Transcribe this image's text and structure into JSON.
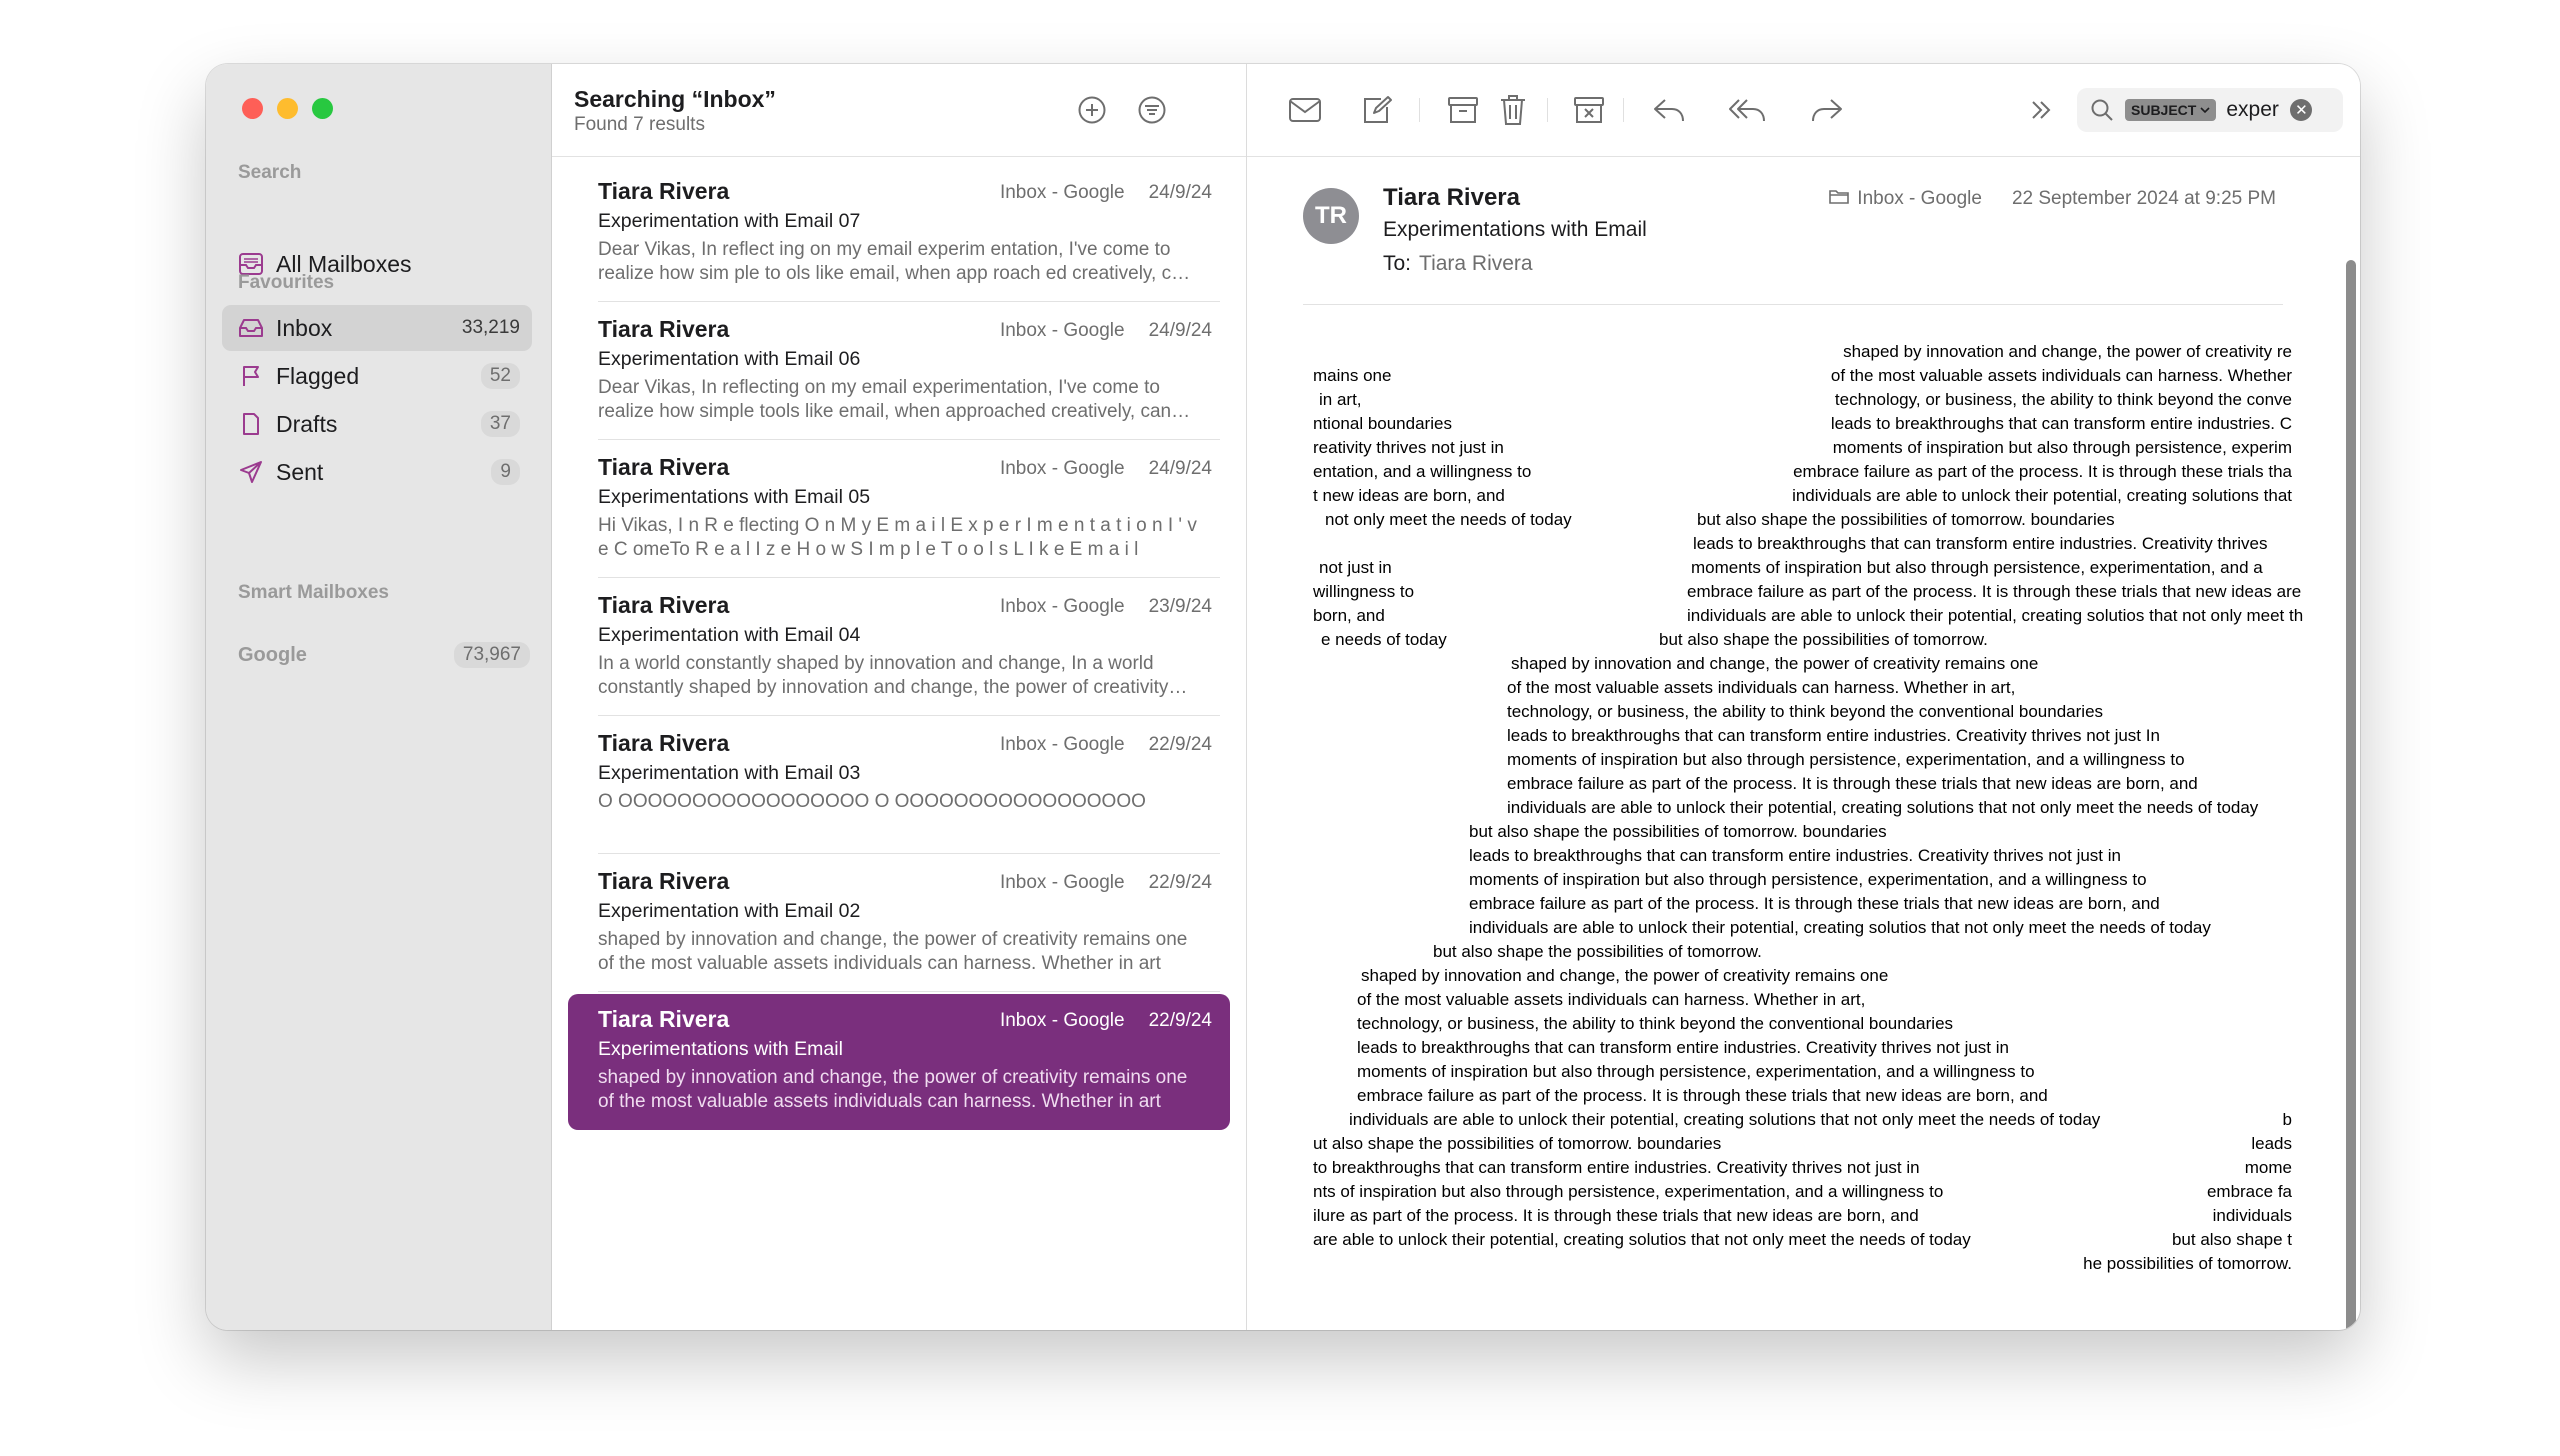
{
  "sidebar": {
    "search_section": "Search",
    "all_mailboxes": "All Mailboxes",
    "favourites_section": "Favourites",
    "items": [
      {
        "label": "Inbox",
        "count": "33,219"
      },
      {
        "label": "Flagged",
        "count": "52"
      },
      {
        "label": "Drafts",
        "count": "37"
      },
      {
        "label": "Sent",
        "count": "9"
      }
    ],
    "smart_section": "Smart Mailboxes",
    "google": {
      "label": "Google",
      "count": "73,967"
    }
  },
  "list": {
    "title": "Searching “Inbox”",
    "subtitle": "Found 7 results",
    "messages": [
      {
        "from": "Tiara Rivera",
        "mailbox": "Inbox - Google",
        "date": "24/9/24",
        "subject": "Experimentation with Email 07",
        "preview": "Dear Vikas, In reflect ing on my email experim entation, I've come to realize how sim ple to ols like email, when app roach ed creatively, can open up new possibilities"
      },
      {
        "from": "Tiara Rivera",
        "mailbox": "Inbox - Google",
        "date": "24/9/24",
        "subject": "Experimentation with Email 06",
        "preview": "Dear Vikas, In reflecting on my email experimentation, I've come to realize how simple tools like email, when approached creatively, can open up new possibilities"
      },
      {
        "from": "Tiara Rivera",
        "mailbox": "Inbox - Google",
        "date": "24/9/24",
        "subject": "Experimentations with Email 05",
        "preview": "Hi Vikas, I n R e flecting O n M y E m a i l E x p e r I m e n t a t i o n I ' v e C omeTo R e a l I z e H o w S I m p l e T o o l s L I k e E m a i l"
      },
      {
        "from": "Tiara Rivera",
        "mailbox": "Inbox - Google",
        "date": "23/9/24",
        "subject": "Experimentation with Email 04",
        "preview": "In a world constantly shaped by innovation and change, In a world constantly shaped by innovation and change, the power of creativity remains one"
      },
      {
        "from": "Tiara Rivera",
        "mailbox": "Inbox - Google",
        "date": "22/9/24",
        "subject": "Experimentation with Email 03",
        "preview": "O OOOOOOOOOOOOOOOOO O OOOOOOOOOOOOOOOOO"
      },
      {
        "from": "Tiara Rivera",
        "mailbox": "Inbox - Google",
        "date": "22/9/24",
        "subject": "Experimentation with Email 02",
        "preview": "shaped by innovation and change, the power of creativity remains one of the most valuable assets individuals can harness. Whether in art"
      },
      {
        "from": "Tiara Rivera",
        "mailbox": "Inbox - Google",
        "date": "22/9/24",
        "subject": "Experimentations with Email",
        "preview": "shaped by innovation and change, the power of creativity remains one of the most valuable assets individuals can harness. Whether in art"
      }
    ]
  },
  "search": {
    "token": "SUBJECT",
    "value": "exper"
  },
  "reader": {
    "avatar": "TR",
    "from": "Tiara Rivera",
    "subject": "Experimentations with Email",
    "to_label": "To:",
    "to": "Tiara Rivera",
    "mailbox": "Inbox - Google",
    "date": "22 September 2024 at 9:25 PM",
    "body_lines": [
      "shaped by innovation and change, the power of creativity re",
      "mains one",
      "of the most valuable assets individuals can harness. Whether",
      "in art,",
      "technology, or business, the ability to think beyond the conve",
      "ntional boundaries",
      "leads to breakthroughs that can transform entire industries. C",
      "reativity thrives not just in",
      "moments of inspiration but also through persistence, experim",
      "entation, and a willingness to",
      "embrace failure as part of the process. It is through these trials tha",
      "t new ideas are born, and",
      "individuals are able to unlock their potential, creating solutions that",
      "not only meet the needs of today",
      "but also shape the possibilities of tomorrow. boundaries",
      "leads to breakthroughs that can transform entire industries. Creativity thrives",
      "not just in",
      "moments of inspiration but also through persistence, experimentation, and a",
      "willingness to",
      "embrace failure as part of the process. It is through these trials that new ideas are",
      "born, and",
      "individuals are able to unlock their potential, creating solutios that not only meet th",
      "e needs of today",
      "but also shape the possibilities of tomorrow.",
      "shaped by innovation and change, the power of creativity remains one",
      "of the most valuable assets individuals can harness. Whether in art,",
      "technology, or business, the ability to think beyond the conventional boundaries",
      "leads to breakthroughs that can transform entire industries. Creativity thrives not just In",
      "moments of inspiration but also through persistence, experimentation, and a willingness to",
      "embrace failure as part of the process. It is through these trials that new ideas are born, and",
      "individuals are able to unlock their potential, creating solutions that not only meet the needs of today",
      "but also shape the possibilities of tomorrow. boundaries",
      "leads to breakthroughs that can transform entire industries. Creativity thrives not just in",
      "moments of inspiration but also through persistence, experimentation, and a willingness to",
      "embrace failure as part of the process. It is through these trials that new ideas are born, and",
      "individuals are able to unlock their potential, creating solutios that not only meet the needs of today",
      "but also shape the possibilities of tomorrow.",
      "shaped by innovation and change, the power of creativity remains one",
      "of the most valuable assets individuals can harness. Whether in art,",
      "technology, or business, the ability to think beyond the conventional boundaries",
      "leads to breakthroughs that can transform entire industries. Creativity thrives not just in",
      "moments of inspiration but also through persistence, experimentation, and a willingness to",
      "embrace failure as part of the process. It is through these trials that new ideas are born, and",
      "individuals are able to unlock their potential, creating solutions that not only meet the needs of today",
      "b",
      "ut also shape the possibilities of tomorrow. boundaries",
      "leads",
      "to breakthroughs that can transform entire industries. Creativity thrives not just in",
      "mome",
      "nts of inspiration but also through persistence, experimentation, and a willingness to",
      "embrace fa",
      "ilure as part of the process. It is through these trials that new ideas are born, and",
      "individuals",
      "are able to unlock their potential, creating solutios that not only meet the needs of today",
      "but also shape t",
      "he possibilities of tomorrow."
    ]
  },
  "colors": {
    "accent": "#7a2f7d",
    "sidebar_icon": "#9b3b8f"
  }
}
